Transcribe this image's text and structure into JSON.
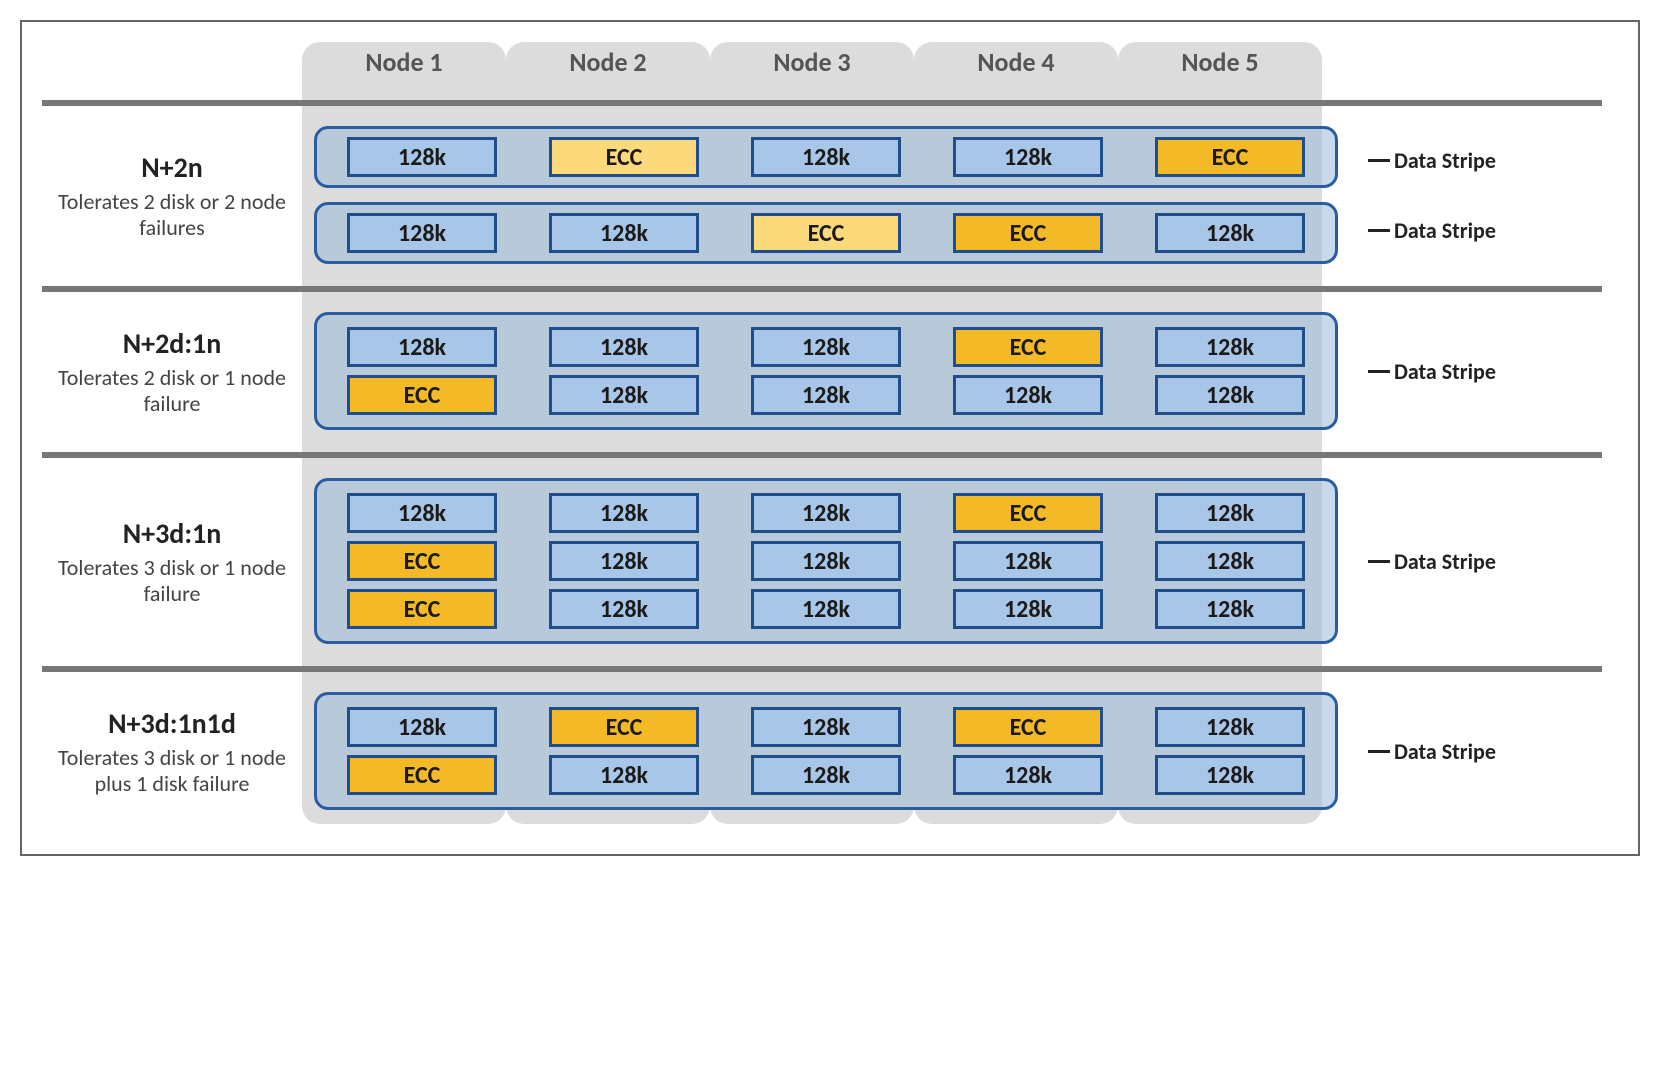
{
  "nodes": [
    "Node 1",
    "Node 2",
    "Node 3",
    "Node 4",
    "Node 5"
  ],
  "data_label": "128k",
  "ecc_label": "ECC",
  "stripe_label": "Data Stripe",
  "schemes": [
    {
      "title": "N+2n",
      "desc": "Tolerates 2 disk or 2 node failures",
      "stripe_callouts": 2,
      "stripes": [
        [
          [
            "data",
            "ecc_light",
            "data",
            "data",
            "ecc"
          ]
        ],
        [
          [
            "data",
            "data",
            "ecc_light",
            "ecc",
            "data"
          ]
        ]
      ]
    },
    {
      "title": "N+2d:1n",
      "desc": "Tolerates 2 disk or 1 node failure",
      "stripe_callouts": 1,
      "stripes": [
        [
          [
            "data",
            "data",
            "data",
            "ecc",
            "data"
          ],
          [
            "ecc",
            "data",
            "data",
            "data",
            "data"
          ]
        ]
      ]
    },
    {
      "title": "N+3d:1n",
      "desc": "Tolerates 3 disk or 1 node failure",
      "stripe_callouts": 1,
      "stripes": [
        [
          [
            "data",
            "data",
            "data",
            "ecc",
            "data"
          ],
          [
            "ecc",
            "data",
            "data",
            "data",
            "data"
          ],
          [
            "ecc",
            "data",
            "data",
            "data",
            "data"
          ]
        ]
      ]
    },
    {
      "title": "N+3d:1n1d",
      "desc": "Tolerates 3 disk or 1 node plus 1 disk failure",
      "stripe_callouts": 1,
      "stripes": [
        [
          [
            "data",
            "ecc",
            "data",
            "ecc",
            "data"
          ],
          [
            "ecc",
            "data",
            "data",
            "data",
            "data"
          ]
        ]
      ]
    }
  ]
}
